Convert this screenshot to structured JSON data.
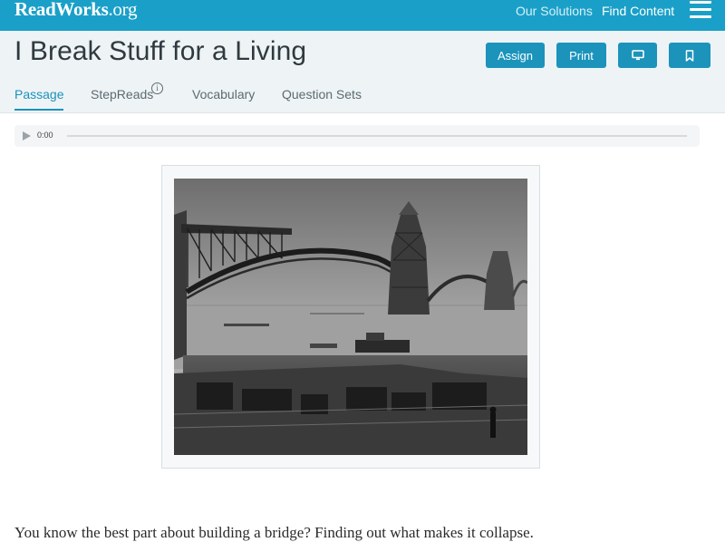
{
  "topbar": {
    "logo_main": "ReadWorks",
    "logo_suffix": ".org",
    "nav": {
      "our_solutions": "Our Solutions",
      "find_content": "Find Content"
    },
    "menu_icon": "hamburger-menu-icon"
  },
  "article": {
    "title": "I Break Stuff for a Living"
  },
  "actions": {
    "assign": "Assign",
    "print": "Print",
    "display_icon": "monitor-icon",
    "bookmark_icon": "bookmark-icon"
  },
  "tabs": [
    {
      "label": "Passage",
      "active": true
    },
    {
      "label": "StepReads",
      "active": false,
      "info_glyph": "i"
    },
    {
      "label": "Vocabulary",
      "active": false
    },
    {
      "label": "Question Sets",
      "active": false
    }
  ],
  "audio": {
    "play_icon": "play-icon",
    "time": "0:00",
    "progress": 0
  },
  "figure": {
    "description_icon": "bridge-construction-photo"
  },
  "passage": {
    "first_line": "You know the best part about building a bridge? Finding out what makes it collapse."
  },
  "colors": {
    "topbar": "#1aa0c8",
    "accent": "#1b93bb",
    "header_bg": "#eef3f5",
    "title_text": "#2f3a40"
  }
}
